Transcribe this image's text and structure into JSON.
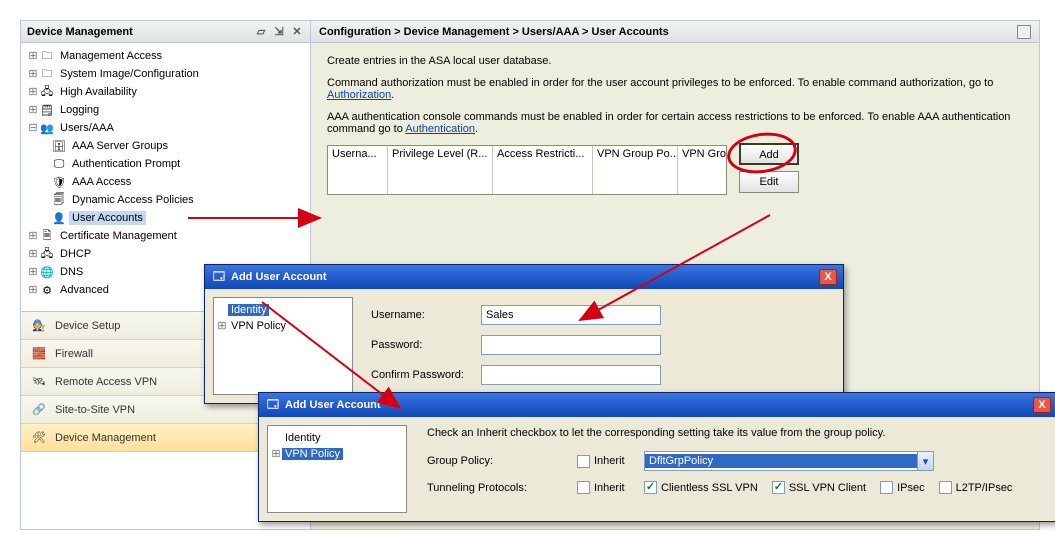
{
  "left": {
    "title": "Device Management",
    "tree": {
      "management_access": "Management Access",
      "system_image": "System Image/Configuration",
      "high_availability": "High Availability",
      "logging": "Logging",
      "users_aaa": "Users/AAA",
      "aaa_server_groups": "AAA Server Groups",
      "authentication_prompt": "Authentication Prompt",
      "aaa_access": "AAA Access",
      "dynamic_access_policies": "Dynamic Access Policies",
      "user_accounts": "User Accounts",
      "certificate_management": "Certificate Management",
      "dhcp": "DHCP",
      "dns": "DNS",
      "advanced": "Advanced"
    },
    "categories": {
      "device_setup": "Device Setup",
      "firewall": "Firewall",
      "remote_access_vpn": "Remote Access VPN",
      "site_to_site_vpn": "Site-to-Site VPN",
      "device_management": "Device Management"
    }
  },
  "right": {
    "breadcrumb": "Configuration > Device Management > Users/AAA > User Accounts",
    "intro": "Create entries in the ASA local user database.",
    "para2a": "Command authorization must be enabled in order for the user account privileges to be enforced. To enable command authorization, go to ",
    "para2_link": "Authorization",
    "para3a": "AAA authentication console commands must be enabled in order for certain access restrictions to be enforced. To enable AAA authentication command go to ",
    "para3_link": "Authentication",
    "cols": {
      "c1": "Userna...",
      "c2": "Privilege Level (R...",
      "c3": "Access Restricti...",
      "c4": "VPN Group Po...",
      "c5": "VPN Group L..."
    },
    "buttons": {
      "add": "Add",
      "edit": "Edit"
    }
  },
  "dlg1": {
    "title": "Add User Account",
    "tree": {
      "identity": "Identity",
      "vpn_policy": "VPN Policy"
    },
    "labels": {
      "username": "Username:",
      "password": "Password:",
      "confirm": "Confirm Password:"
    },
    "values": {
      "username": "Sales",
      "password": "",
      "confirm": ""
    }
  },
  "dlg2": {
    "title": "Add User Account",
    "tree": {
      "identity": "Identity",
      "vpn_policy": "VPN Policy"
    },
    "desc": "Check an Inherit checkbox to let the corresponding setting take its value from the group policy.",
    "labels": {
      "group_policy": "Group Policy:",
      "tunneling": "Tunneling Protocols:",
      "inherit": "Inherit",
      "clientless": "Clientless SSL VPN",
      "sslvpn": "SSL VPN Client",
      "ipsec": "IPsec",
      "l2tp": "L2TP/IPsec"
    },
    "values": {
      "group_policy": "DfltGrpPolicy"
    }
  }
}
